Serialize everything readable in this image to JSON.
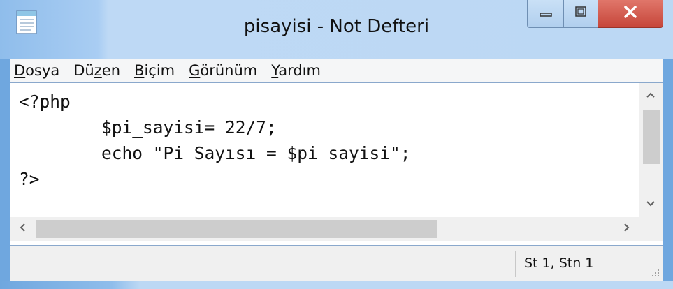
{
  "window": {
    "title": "pisayisi - Not Defteri"
  },
  "menu": {
    "items": [
      {
        "label_pre": "",
        "label_key": "D",
        "label_post": "osya"
      },
      {
        "label_pre": "Dü",
        "label_key": "z",
        "label_post": "en"
      },
      {
        "label_pre": "",
        "label_key": "B",
        "label_post": "içim"
      },
      {
        "label_pre": "",
        "label_key": "G",
        "label_post": "örünüm"
      },
      {
        "label_pre": "",
        "label_key": "Y",
        "label_post": "ardım"
      }
    ]
  },
  "editor": {
    "lines": [
      "<?php",
      "\t$pi_sayisi= 22/7;",
      "\techo \"Pi Sayısı = $pi_sayisi\";",
      "?>"
    ]
  },
  "status": {
    "position": "St 1, Stn 1"
  },
  "icons": {
    "app": "notepad-icon",
    "minimize": "minimize-icon",
    "maximize": "maximize-icon",
    "close": "close-icon"
  },
  "colors": {
    "title_bg": "#bcd8f4",
    "close_bg": "#c6463a",
    "editor_bg": "#ffffff",
    "statusbar_bg": "#f0f0f0"
  }
}
